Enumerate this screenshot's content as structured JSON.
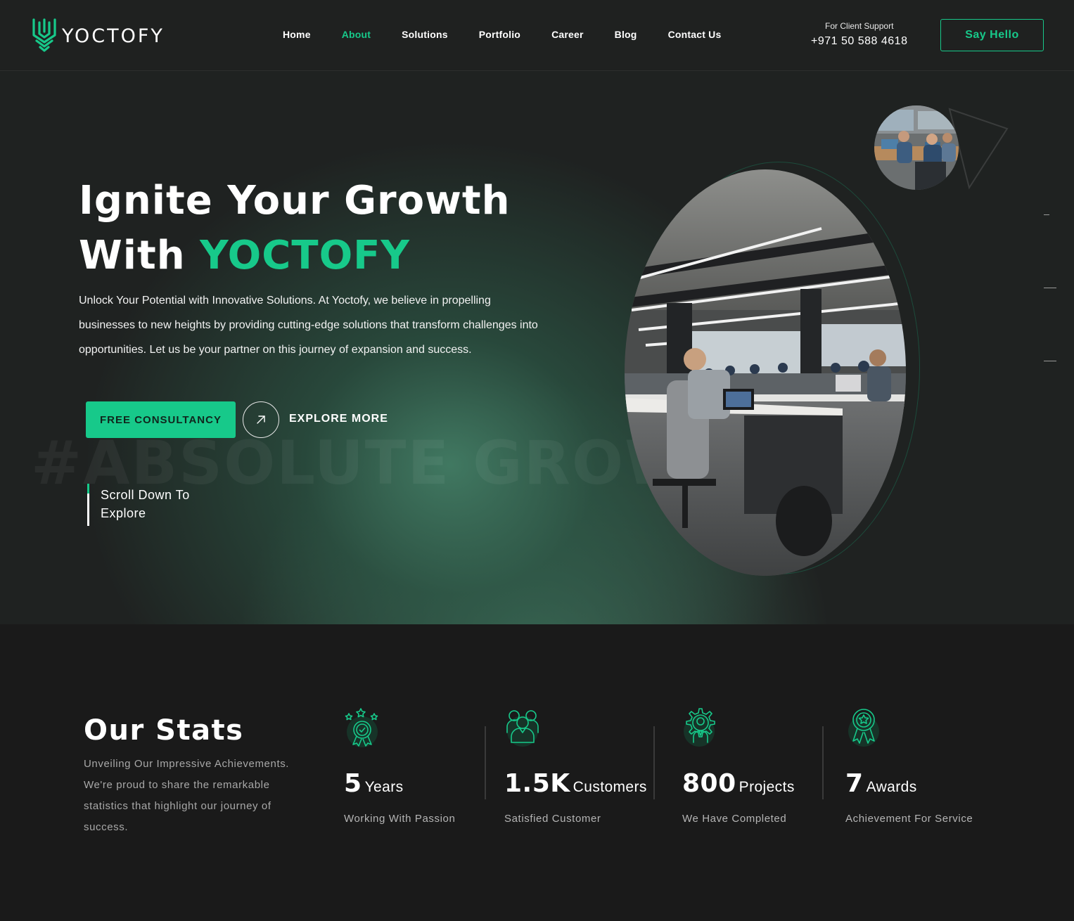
{
  "header": {
    "logo_text": "YOCTOFY",
    "nav": [
      {
        "label": "Home",
        "active": false
      },
      {
        "label": "About",
        "active": true
      },
      {
        "label": "Solutions",
        "active": false
      },
      {
        "label": "Portfolio",
        "active": false
      },
      {
        "label": "Career",
        "active": false
      },
      {
        "label": "Blog",
        "active": false
      },
      {
        "label": "Contact Us",
        "active": false
      }
    ],
    "support_label": "For Client Support",
    "support_phone": "+971 50 588 4618",
    "cta_label": "Say Hello"
  },
  "hero": {
    "title_line1": "Ignite Your Growth",
    "title_line2_prefix": "With ",
    "title_brand": "YOCTOFY",
    "description": "Unlock Your Potential with Innovative Solutions. At Yoctofy, we believe in propelling businesses to new heights by providing cutting-edge solutions that transform challenges into opportunities. Let us be your partner on this journey of expansion and success.",
    "primary_button": "FREE CONSULTANCY",
    "secondary_button": "EXPLORE MORE",
    "watermark": "#ABSOLUTE GROWTH",
    "scroll_line1": "Scroll Down To",
    "scroll_line2": "Explore"
  },
  "stats": {
    "title": "Our Stats",
    "description": "Unveiling Our Impressive Achievements. We're proud to share the remarkable statistics that highlight our journey of success.",
    "items": [
      {
        "value": "5",
        "unit": "Years",
        "caption": "Working With Passion",
        "icon": "award-medal-stars-icon"
      },
      {
        "value": "1.5K",
        "unit": "Customers",
        "caption": "Satisfied Customer",
        "icon": "customers-group-icon"
      },
      {
        "value": "800",
        "unit": "Projects",
        "caption": "We Have Completed",
        "icon": "gear-person-icon"
      },
      {
        "value": "7",
        "unit": "Awards",
        "caption": "Achievement For Service",
        "icon": "award-ribbon-icon"
      }
    ]
  },
  "colors": {
    "accent": "#17c98a",
    "header_bg": "#1f2120",
    "page_bg": "#1a1a1a"
  }
}
